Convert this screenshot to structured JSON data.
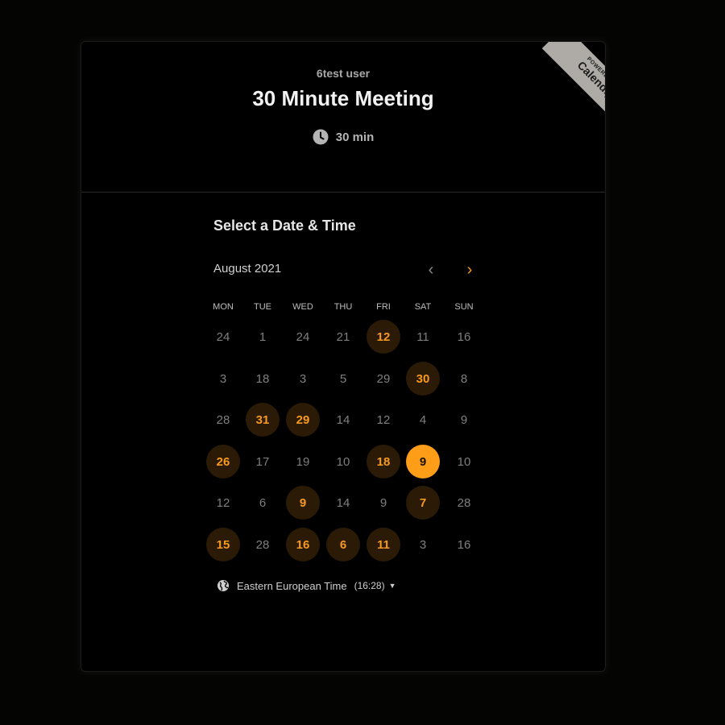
{
  "header": {
    "owner": "6test user",
    "title": "30 Minute Meeting",
    "duration": "30 min"
  },
  "ribbon": {
    "line1": "POWERED BY",
    "brand": "Calendly"
  },
  "calendar": {
    "section_title": "Select a Date & Time",
    "month_label": "August 2021",
    "prev_icon": "‹",
    "next_icon": "›",
    "weekdays": [
      "MON",
      "TUE",
      "WED",
      "THU",
      "FRI",
      "SAT",
      "SUN"
    ],
    "weeks": [
      [
        {
          "d": "24",
          "s": "n"
        },
        {
          "d": "1",
          "s": "n"
        },
        {
          "d": "24",
          "s": "n"
        },
        {
          "d": "21",
          "s": "n"
        },
        {
          "d": "12",
          "s": "a"
        },
        {
          "d": "11",
          "s": "n"
        },
        {
          "d": "16",
          "s": "n"
        }
      ],
      [
        {
          "d": "3",
          "s": "n"
        },
        {
          "d": "18",
          "s": "n"
        },
        {
          "d": "3",
          "s": "n"
        },
        {
          "d": "5",
          "s": "n"
        },
        {
          "d": "29",
          "s": "n"
        },
        {
          "d": "30",
          "s": "a"
        },
        {
          "d": "8",
          "s": "n"
        }
      ],
      [
        {
          "d": "28",
          "s": "n"
        },
        {
          "d": "31",
          "s": "a"
        },
        {
          "d": "29",
          "s": "a"
        },
        {
          "d": "14",
          "s": "n"
        },
        {
          "d": "12",
          "s": "n"
        },
        {
          "d": "4",
          "s": "n"
        },
        {
          "d": "9",
          "s": "n"
        }
      ],
      [
        {
          "d": "26",
          "s": "a"
        },
        {
          "d": "17",
          "s": "n"
        },
        {
          "d": "19",
          "s": "n"
        },
        {
          "d": "10",
          "s": "n"
        },
        {
          "d": "18",
          "s": "a"
        },
        {
          "d": "9",
          "s": "s"
        },
        {
          "d": "10",
          "s": "n"
        }
      ],
      [
        {
          "d": "12",
          "s": "n"
        },
        {
          "d": "6",
          "s": "n"
        },
        {
          "d": "9",
          "s": "a"
        },
        {
          "d": "14",
          "s": "n"
        },
        {
          "d": "9",
          "s": "n"
        },
        {
          "d": "7",
          "s": "a"
        },
        {
          "d": "28",
          "s": "n"
        }
      ],
      [
        {
          "d": "15",
          "s": "a"
        },
        {
          "d": "28",
          "s": "n"
        },
        {
          "d": "16",
          "s": "a"
        },
        {
          "d": "6",
          "s": "a"
        },
        {
          "d": "11",
          "s": "a"
        },
        {
          "d": "3",
          "s": "n"
        },
        {
          "d": "16",
          "s": "n"
        }
      ]
    ]
  },
  "timezone": {
    "label": "Eastern European Time",
    "time": "(16:28)"
  },
  "colors": {
    "accent": "#fd9d18",
    "available_bg": "#2a1a06",
    "background": "#000000"
  },
  "icons": [
    "clock-icon",
    "globe-icon",
    "chevron-left-icon",
    "chevron-right-icon",
    "caret-down-icon"
  ]
}
